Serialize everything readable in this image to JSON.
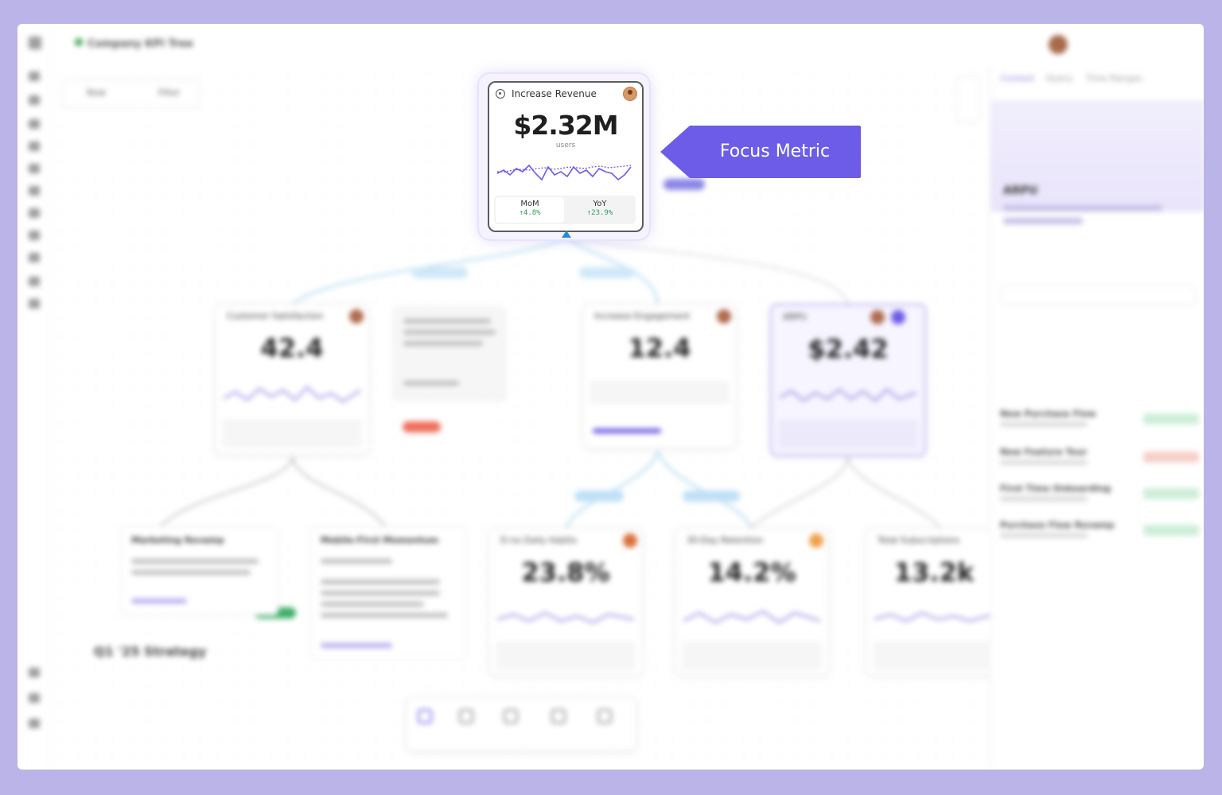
{
  "app": {
    "title": "Company KPI Tree"
  },
  "focus_card": {
    "title": "Increase Revenue",
    "value": "$2.32M",
    "unit": "users",
    "mom_label": "MoM",
    "mom_value": "↑4.8%",
    "yoy_label": "YoY",
    "yoy_value": "↑23.9%"
  },
  "callout": {
    "text": "Focus Metric"
  },
  "toolbar": {
    "view_label": "Now",
    "filter_label": "Filter"
  },
  "cards": [
    {
      "title": "Customer Satisfaction",
      "value": "42.4"
    },
    {
      "title": "Increase Engagement",
      "value": "12.4"
    },
    {
      "title": "ARPU",
      "value": "$2.42"
    },
    {
      "title": "D-no Daily Habits",
      "value": "23.8%"
    },
    {
      "title": "30-Day Retention",
      "value": "14.2%"
    },
    {
      "title": "Total Subscriptions",
      "value": "13.2k"
    }
  ],
  "notes": [
    {
      "title": "Marketing Revamp"
    },
    {
      "title": "Mobile-First Momentum"
    }
  ],
  "canvas": {
    "strategy_label": "Q1 '25 Strategy"
  },
  "panel": {
    "tabs": [
      "Context",
      "Query",
      "Time Ranges"
    ],
    "metric_title": "ARPU",
    "rows": [
      {
        "name": "New Purchase Flow"
      },
      {
        "name": "New Feature Tour"
      },
      {
        "name": "First Time Onboarding"
      },
      {
        "name": "Purchase Flow Revamp"
      }
    ]
  },
  "colors": {
    "accent": "#6c5ce7",
    "positive": "#2e9d5a",
    "frame": "#bab4e8"
  }
}
